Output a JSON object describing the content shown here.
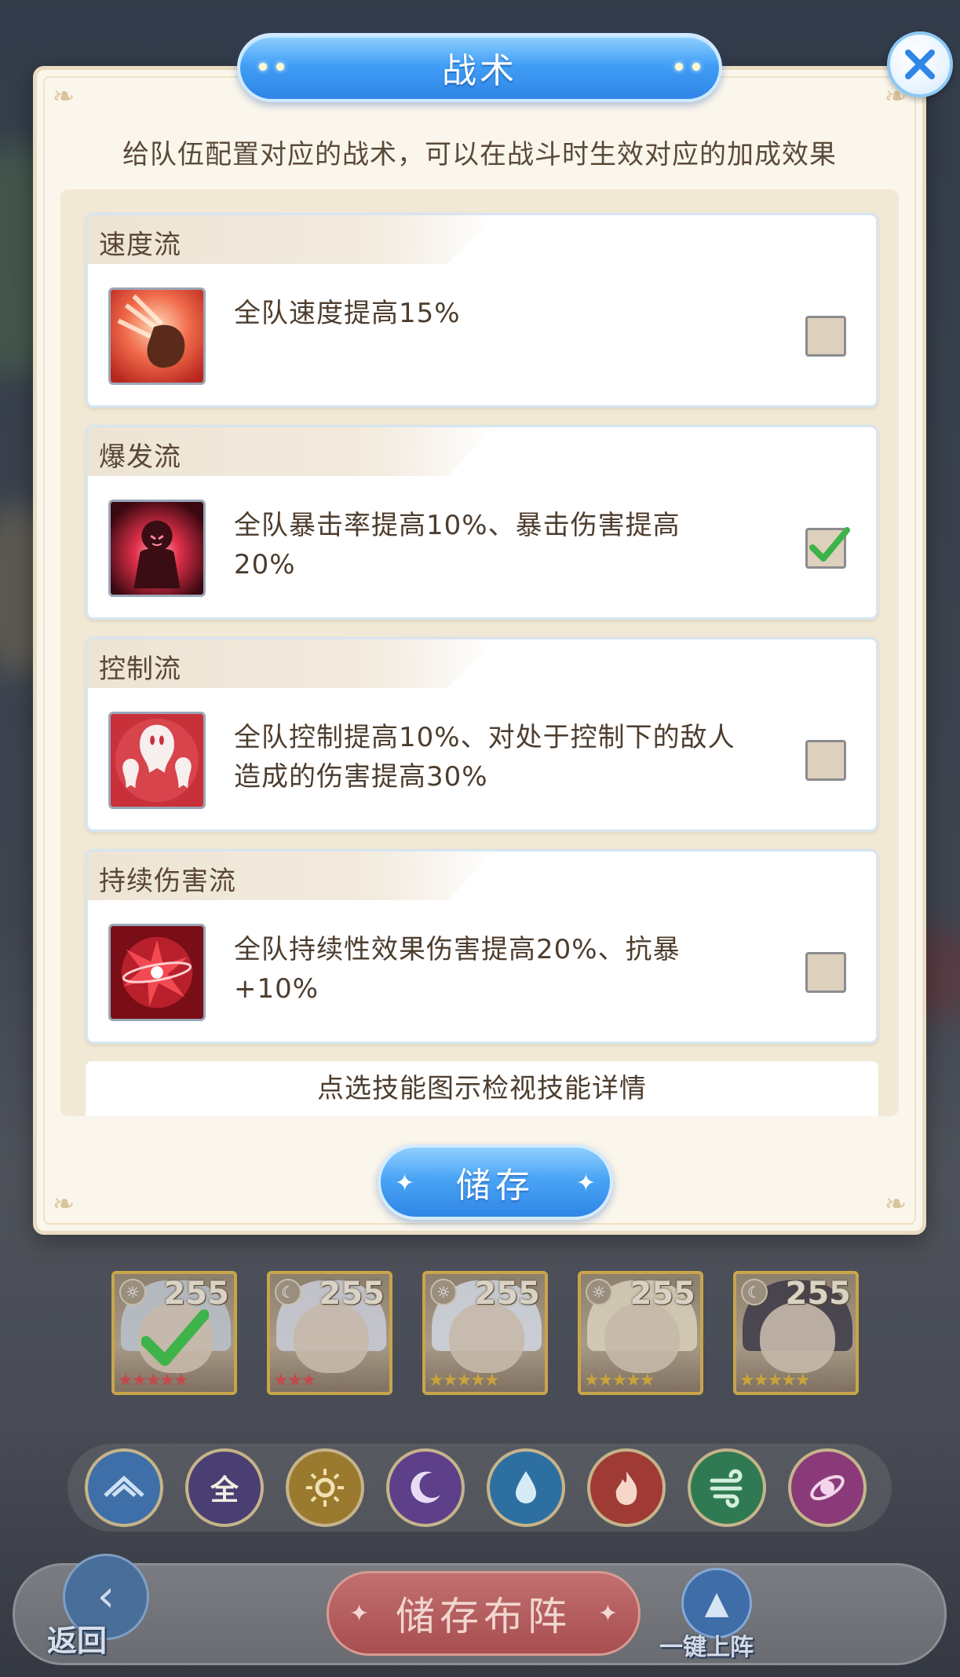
{
  "modal": {
    "title": "战术",
    "subtitle": "给队伍配置对应的战术，可以在战斗时生效对应的加成效果",
    "hint": "点选技能图示检视技能详情",
    "save_label": "储存"
  },
  "tactics": [
    {
      "name": "速度流",
      "desc": "全队速度提高15%",
      "checked": false,
      "icon": "speed-fist-icon"
    },
    {
      "name": "爆发流",
      "desc": "全队暴击率提高10%、暴击伤害提高20%",
      "checked": true,
      "icon": "burst-demon-icon"
    },
    {
      "name": "控制流",
      "desc": "全队控制提高10%、对处于控制下的敌人造成的伤害提高30%",
      "checked": false,
      "icon": "control-ghosts-icon"
    },
    {
      "name": "持续伤害流",
      "desc": "全队持续性效果伤害提高20%、抗暴+10%",
      "checked": false,
      "icon": "dot-burst-icon"
    }
  ],
  "heroes": [
    {
      "level": "255",
      "stars": 5,
      "selected": true
    },
    {
      "level": "255",
      "stars": 3,
      "selected": false
    },
    {
      "level": "255",
      "stars": 5,
      "selected": false
    },
    {
      "level": "255",
      "stars": 5,
      "selected": false
    },
    {
      "level": "255",
      "stars": 5,
      "selected": false
    }
  ],
  "filters": [
    {
      "icon": "wing-icon",
      "label": ""
    },
    {
      "icon": "all-icon",
      "label": "全"
    },
    {
      "icon": "sun-icon",
      "label": ""
    },
    {
      "icon": "moon-icon",
      "label": ""
    },
    {
      "icon": "water-icon",
      "label": ""
    },
    {
      "icon": "fire-icon",
      "label": ""
    },
    {
      "icon": "wind-icon",
      "label": ""
    },
    {
      "icon": "orbit-icon",
      "label": ""
    }
  ],
  "bottom": {
    "back_label": "返回",
    "save_formation_label": "储存布阵",
    "quick_deploy_label": "一键上阵"
  },
  "colors": {
    "accent_blue": "#3f9df5",
    "panel_cream": "#fbf6ec",
    "check_green": "#3db34a"
  }
}
